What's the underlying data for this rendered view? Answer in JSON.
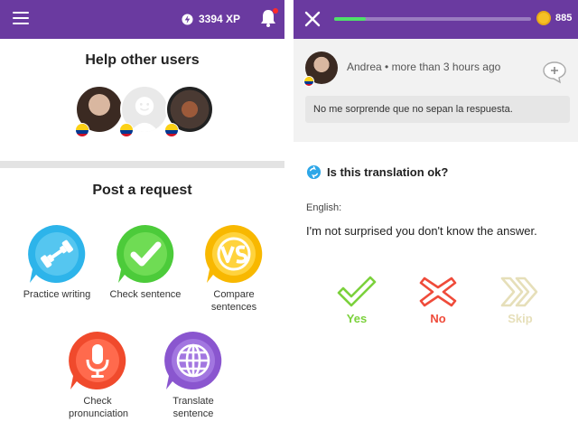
{
  "left": {
    "topbar": {
      "xp": "3394 XP"
    },
    "help_title": "Help other users",
    "post_title": "Post a request",
    "tiles": [
      {
        "label": "Practice writing",
        "color": "#2db4ea"
      },
      {
        "label": "Check sentence",
        "color": "#4ccb3a"
      },
      {
        "label": "Compare sentences",
        "color": "#f8b800"
      },
      {
        "label": "Check pronunciation",
        "color": "#f04a2c"
      },
      {
        "label": "Translate sentence",
        "color": "#8a56cf"
      }
    ]
  },
  "right": {
    "topbar": {
      "progress": 0.16,
      "coins": "885"
    },
    "author": "Andrea • more than 3 hours ago",
    "sentence": "No me sorprende que no sepan la respuesta.",
    "question": "Is this translation ok?",
    "language_label": "English:",
    "translation": "I'm not surprised you don't know the answer.",
    "choices": [
      {
        "label": "Yes",
        "color": "#7bd13c"
      },
      {
        "label": "No",
        "color": "#ef4b3a"
      },
      {
        "label": "Skip",
        "color": "#e6dfb9"
      }
    ]
  },
  "colors": {
    "brand": "#6a3aa0"
  },
  "icons": [
    "menu-icon",
    "lightning-icon",
    "bell-icon",
    "dumbbell-icon",
    "checkmark-icon",
    "vs-icon",
    "microphone-icon",
    "globe-icon",
    "close-icon",
    "coin-icon",
    "comment-add-icon",
    "translate-icon"
  ]
}
